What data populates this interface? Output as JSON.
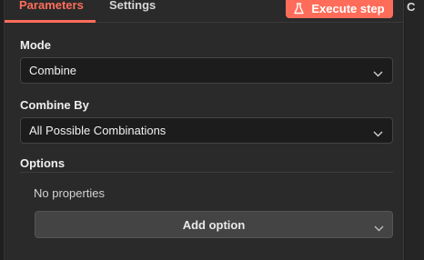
{
  "tabs": [
    {
      "label": "Parameters",
      "active": true
    },
    {
      "label": "Settings",
      "active": false
    }
  ],
  "execute_button": {
    "label": "Execute step",
    "icon": "flask-icon"
  },
  "right_strip": {
    "glyph": "C"
  },
  "mode": {
    "label": "Mode",
    "value": "Combine"
  },
  "combine_by": {
    "label": "Combine By",
    "value": "All Possible Combinations"
  },
  "options": {
    "label": "Options",
    "empty_text": "No properties",
    "add_label": "Add option"
  },
  "colors": {
    "accent": "#ff6d5a",
    "panel": "#2a2a2a",
    "input_bg": "#1c1c1c",
    "button_bg": "#444444"
  }
}
